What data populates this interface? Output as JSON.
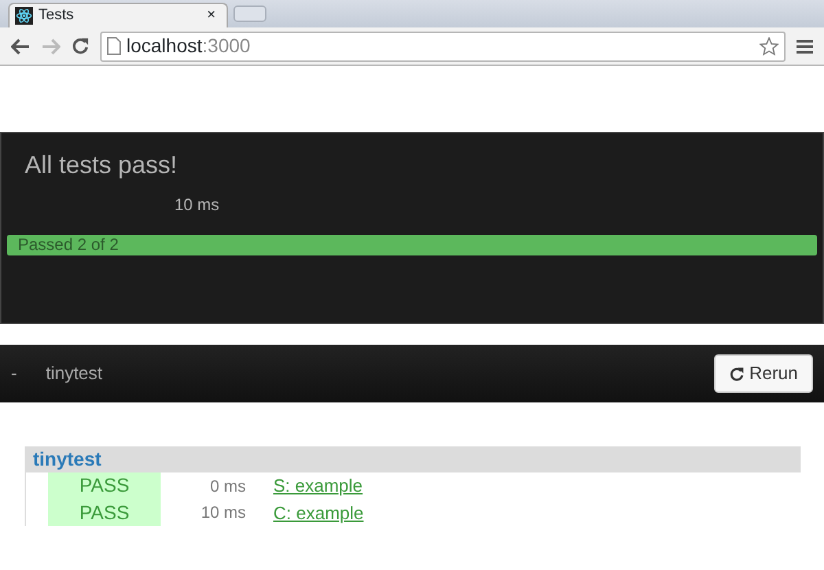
{
  "browser": {
    "tab": {
      "title": "Tests",
      "close": "×"
    },
    "address": {
      "host": "localhost",
      "port": ":3000"
    }
  },
  "summary": {
    "title": "All tests pass!",
    "duration": "10 ms",
    "progress": {
      "label": "Passed 2 of 2",
      "level": 1
    }
  },
  "toolbar": {
    "toggle": "-",
    "suite": "tinytest",
    "rerun": "Rerun"
  },
  "group": {
    "name": "tinytest",
    "tests": [
      {
        "status": "PASS",
        "passed": true,
        "time": "0 ms",
        "name": "S: example"
      },
      {
        "status": "PASS",
        "passed": true,
        "time": "10 ms",
        "name": "C: example"
      }
    ]
  }
}
